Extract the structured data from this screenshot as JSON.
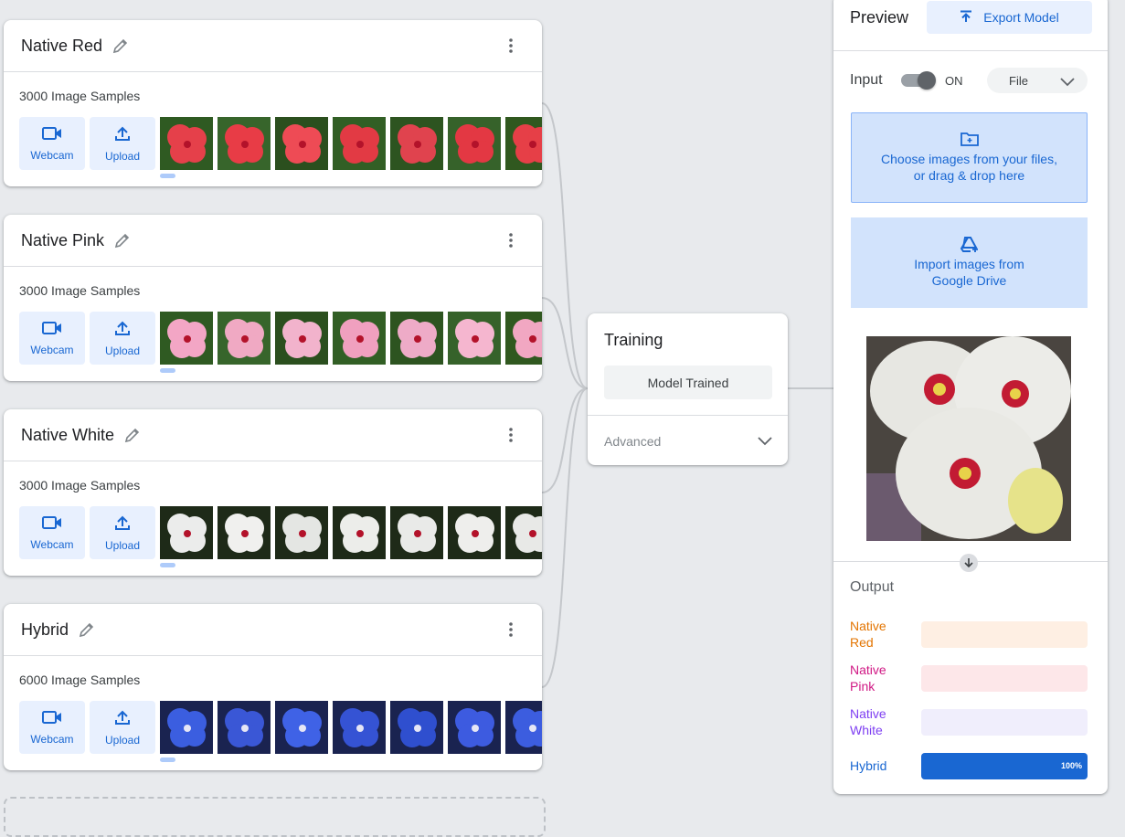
{
  "classes": [
    {
      "name": "Native Red",
      "samples": "3000 Image Samples",
      "thumb_hues": [
        "#e5404a",
        "#e83c46",
        "#ee4b55",
        "#e23a44",
        "#e0434e",
        "#e33843",
        "#e63f47"
      ]
    },
    {
      "name": "Native Pink",
      "samples": "3000 Image Samples",
      "thumb_hues": [
        "#f3a6c5",
        "#f0a9c3",
        "#f2b3cc",
        "#f0a0bf",
        "#eeabc7",
        "#f5b6cf",
        "#f1a7c2"
      ]
    },
    {
      "name": "Native White",
      "samples": "3000 Image Samples",
      "thumb_hues": [
        "#ebeceb",
        "#f0f0ee",
        "#e4e6e3",
        "#ecedea",
        "#e9eae8",
        "#eeeeec",
        "#e8e9e7"
      ]
    },
    {
      "name": "Hybrid",
      "samples": "6000 Image Samples",
      "thumb_hues": [
        "#3b5ee0",
        "#3a57d6",
        "#3f62e6",
        "#3553d4",
        "#2f4fcf",
        "#3d5be0",
        "#3c5ddf"
      ]
    }
  ],
  "buttons": {
    "webcam": "Webcam",
    "upload": "Upload"
  },
  "training": {
    "title": "Training",
    "status_button": "Model Trained",
    "advanced": "Advanced"
  },
  "preview": {
    "title": "Preview",
    "export": "Export Model",
    "input_label": "Input",
    "toggle_state": "ON",
    "source_select": "File",
    "choose_line1": "Choose images from your files,",
    "choose_line2": "or drag & drop here",
    "drive_line1": "Import images from",
    "drive_line2": "Google Drive"
  },
  "output": {
    "title": "Output",
    "rows": [
      {
        "line1": "Native",
        "line2": "Red",
        "color": "#e37400",
        "bg": "#feefe3",
        "fill_color": "#e37400",
        "value": 0,
        "pct": ""
      },
      {
        "line1": "Native",
        "line2": "Pink",
        "color": "#d01884",
        "bg": "#fde7e9",
        "fill_color": "#d01884",
        "value": 0,
        "pct": ""
      },
      {
        "line1": "Native",
        "line2": "White",
        "color": "#7e3ff2",
        "bg": "#f0eefc",
        "fill_color": "#7e3ff2",
        "value": 0,
        "pct": ""
      },
      {
        "line1": "Hybrid",
        "line2": "",
        "color": "#1967d2",
        "bg": "#d2e3fc",
        "fill_color": "#1967d2",
        "value": 100,
        "pct": "100%"
      }
    ]
  },
  "colors": {
    "accent": "#1967d2",
    "accent_bg": "#e8f0fe"
  }
}
